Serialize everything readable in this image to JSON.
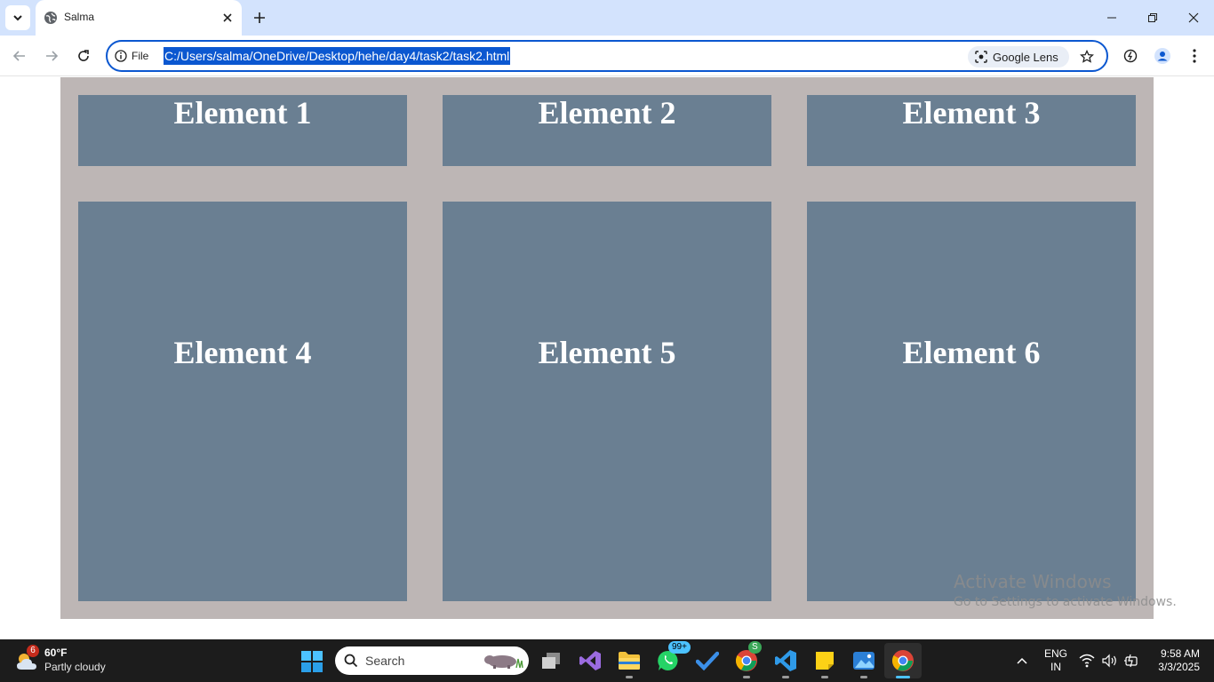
{
  "browser": {
    "tab": {
      "title": "Salma"
    },
    "address_bar": {
      "site_info_label": "File",
      "url": "C:/Users/salma/OneDrive/Desktop/hehe/day4/task2/task2.html"
    },
    "lens_label": "Google Lens",
    "colors": {
      "tabstrip": "#d3e3fd",
      "accent": "#0b57d0"
    }
  },
  "page": {
    "elements": [
      {
        "label": "Element 1"
      },
      {
        "label": "Element 2"
      },
      {
        "label": "Element 3"
      },
      {
        "label": "Element 4"
      },
      {
        "label": "Element 5"
      },
      {
        "label": "Element 6"
      }
    ],
    "colors": {
      "container": "#bdb6b5",
      "item": "#6a7f92",
      "item_text": "#ffffff"
    }
  },
  "watermark": {
    "title": "Activate Windows",
    "subtitle": "Go to Settings to activate Windows."
  },
  "taskbar": {
    "weather": {
      "badge": "6",
      "temp": "60°F",
      "desc": "Partly cloudy"
    },
    "search_placeholder": "Search",
    "whatsapp_badge": "99+",
    "chrome_profile_badge": "S",
    "language": {
      "line1": "ENG",
      "line2": "IN"
    },
    "clock": {
      "time": "9:58 AM",
      "date": "3/3/2025"
    }
  }
}
